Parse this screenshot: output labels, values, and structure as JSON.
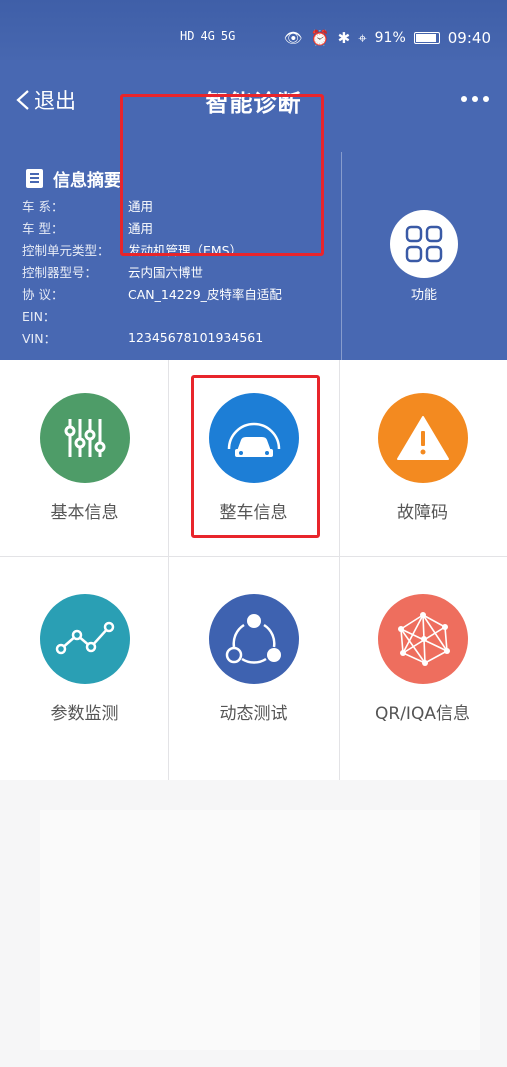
{
  "status_bar": {
    "left_icons": [
      "HD",
      "4G",
      "5G"
    ],
    "battery_percent": "91%",
    "time": "09:40"
  },
  "nav": {
    "back_label": "退出",
    "title": "智能诊断"
  },
  "info": {
    "title": "信息摘要",
    "rows": [
      {
        "label": "车 系：",
        "value": "通用"
      },
      {
        "label": "车 型：",
        "value": "通用"
      },
      {
        "label": "控制单元类型：",
        "value": "发动机管理（EMS）"
      },
      {
        "label": "控制器型号：",
        "value": "云内国六博世"
      },
      {
        "label": "协 议：",
        "value": "CAN_14229_皮特率自适配"
      },
      {
        "label": "EIN：",
        "value": ""
      },
      {
        "label": "VIN：",
        "value": "12345678101934561"
      }
    ]
  },
  "function_button": {
    "label": "功能"
  },
  "grid": [
    {
      "label": "基本信息",
      "color": "#4e9c68",
      "icon": "sliders-icon"
    },
    {
      "label": "整车信息",
      "color": "#1d7ed6",
      "icon": "car-icon"
    },
    {
      "label": "故障码",
      "color": "#f38a20",
      "icon": "warning-icon"
    },
    {
      "label": "参数监测",
      "color": "#2a9fb4",
      "icon": "line-chart-icon"
    },
    {
      "label": "动态测试",
      "color": "#3e62b0",
      "icon": "share-cycle-icon"
    },
    {
      "label": "QR/IQA信息",
      "color": "#ee6e5e",
      "icon": "network-icon"
    }
  ],
  "colors": {
    "header": "#4868b2",
    "highlight": "#e8252b"
  }
}
